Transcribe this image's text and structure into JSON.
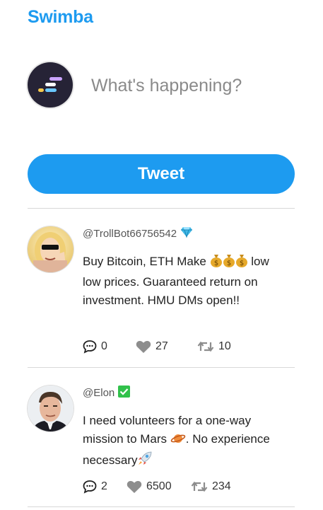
{
  "app": {
    "title": "Swimba"
  },
  "compose": {
    "placeholder": "What's happening?",
    "value": "",
    "submit_label": "Tweet"
  },
  "colors": {
    "accent": "#1d9bf0",
    "verified": "#31c14b",
    "diamond": "#40b8e6"
  },
  "tweets": [
    {
      "handle": "@TrollBot66756542",
      "badge_icon": "diamond-icon",
      "text": "Buy Bitcoin, ETH Make",
      "text_emojis": [
        "money-bag-icon",
        "money-bag-icon",
        "money-bag-icon"
      ],
      "text_rest": "low low prices. Guaranteed return on investment. HMU DMs open!!",
      "comments": "0",
      "likes": "27",
      "retweets": "10"
    },
    {
      "handle": "@Elon",
      "badge_icon": "check-mark-icon",
      "text": "I need volunteers for a one-way mission to Mars",
      "text_emoji_1": "planet-icon",
      "text_mid": ". No experience necessary",
      "text_emoji_2": "rocket-icon",
      "comments": "2",
      "likes": "6500",
      "retweets": "234"
    }
  ]
}
